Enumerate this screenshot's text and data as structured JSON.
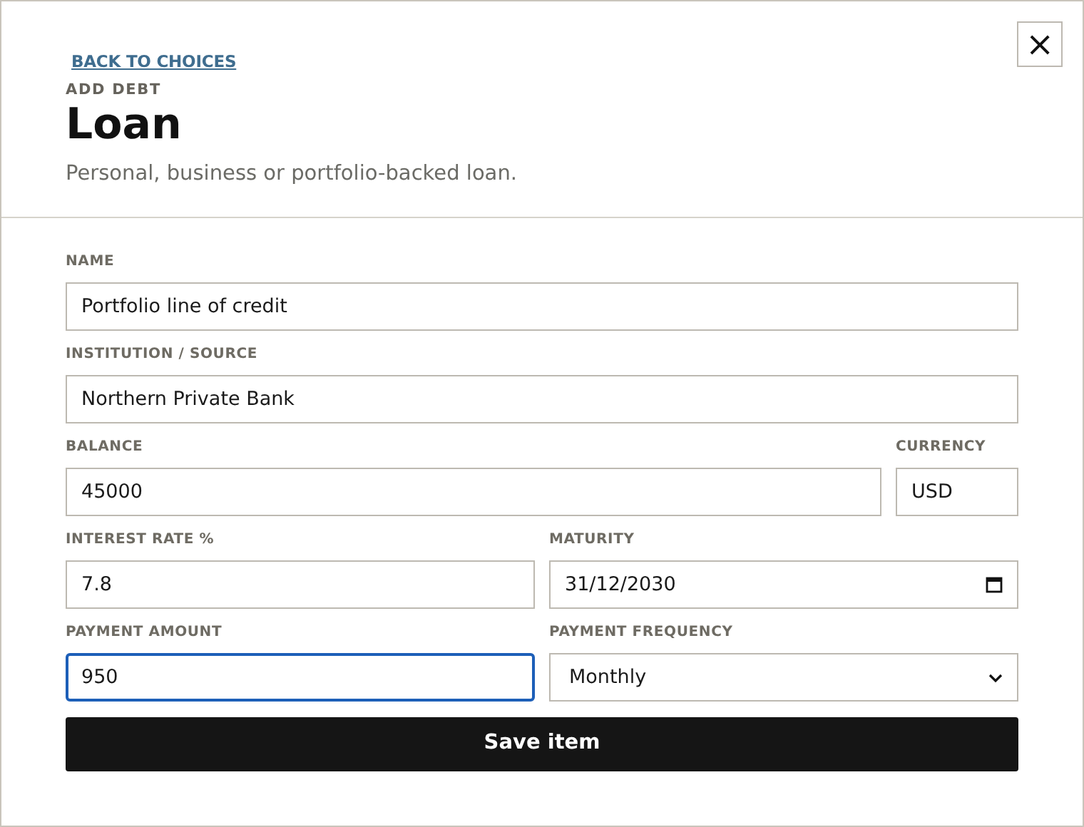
{
  "back_link": "BACK TO CHOICES",
  "close_button": "×",
  "header": {
    "eyebrow": "ADD DEBT",
    "title": "Loan",
    "subtitle": "Personal, business or portfolio-backed loan."
  },
  "form": {
    "rows": [
      [
        {
          "label": "NAME",
          "value": "Portfolio line of credit",
          "kind": "text",
          "focused": false
        }
      ],
      [
        {
          "label": "INSTITUTION / SOURCE",
          "value": "Northern Private Bank",
          "kind": "text",
          "focused": false
        }
      ],
      [
        {
          "label": "BALANCE",
          "value": "45000",
          "kind": "text",
          "focused": false
        },
        {
          "label": "CURRENCY",
          "value": "USD",
          "kind": "text",
          "focused": false
        }
      ],
      [
        {
          "label": "INTEREST RATE %",
          "value": "7.8",
          "kind": "text",
          "focused": false
        },
        {
          "label": "MATURITY",
          "value": "31/12/2030",
          "kind": "date",
          "focused": false
        }
      ],
      [
        {
          "label": "PAYMENT AMOUNT",
          "value": "950",
          "kind": "text",
          "focused": true
        },
        {
          "label": "PAYMENT FREQUENCY",
          "value": "Monthly",
          "kind": "select",
          "focused": false
        }
      ]
    ],
    "submit": "Save item"
  }
}
